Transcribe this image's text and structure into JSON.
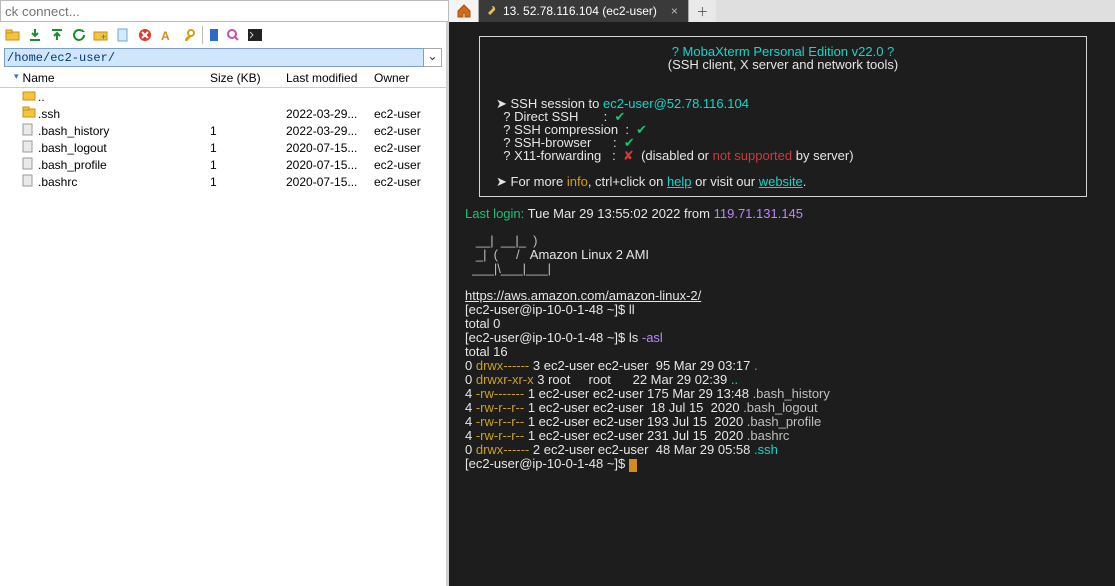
{
  "quickConnect": {
    "placeholder": "ck connect..."
  },
  "tab": {
    "title": "13. 52.78.116.104 (ec2-user)"
  },
  "sftp": {
    "path": "/home/ec2-user/",
    "columns": {
      "name": "Name",
      "size": "Size (KB)",
      "modified": "Last modified",
      "owner": "Owner"
    },
    "rows": [
      {
        "icon": "parent",
        "name": "..",
        "size": "",
        "mod": "",
        "own": ""
      },
      {
        "icon": "folder",
        "name": ".ssh",
        "size": "",
        "mod": "2022-03-29...",
        "own": "ec2-user"
      },
      {
        "icon": "file",
        "name": ".bash_history",
        "size": "1",
        "mod": "2022-03-29...",
        "own": "ec2-user"
      },
      {
        "icon": "file",
        "name": ".bash_logout",
        "size": "1",
        "mod": "2020-07-15...",
        "own": "ec2-user"
      },
      {
        "icon": "file",
        "name": ".bash_profile",
        "size": "1",
        "mod": "2020-07-15...",
        "own": "ec2-user"
      },
      {
        "icon": "file",
        "name": ".bashrc",
        "size": "1",
        "mod": "2020-07-15...",
        "own": "ec2-user"
      }
    ]
  },
  "terminal": {
    "banner": {
      "titleline": "    ? MobaXterm Personal Edition v22.0 ?    ",
      "subtitle": "(SSH client, X server and network tools)",
      "sessionPrefix": "➤ SSH session to ",
      "sessionUser": "ec2-user@52.78.116.104",
      "optDirect": "  ? Direct SSH       :  ",
      "optCompr": "  ? SSH compression  :  ",
      "optBrowse": "  ? SSH-browser      :  ",
      "optX11": "  ? X11-forwarding   :  ",
      "optX11tail1": "  (disabled",
      "optX11tail2": " or ",
      "optX11tail3": "not supported",
      "optX11tail4": " by server)",
      "infoPre": "➤ For more ",
      "infoWord": "info",
      "infoMid": ", ctrl+click on ",
      "helpWord": "help",
      "infoMid2": " or visit our ",
      "webWord": "website",
      "infoEnd": "."
    },
    "lastLoginLabel": "Last login:",
    "lastLoginRest": " Tue Mar 29 13:55:02 2022 from ",
    "lastLoginIp": "119.71.131.145",
    "art1": "   __|  __|_  )",
    "art2a": "   _|  (     /   ",
    "art2b": "Amazon Linux 2 AMI",
    "art3": "  ___|\\___|___|",
    "blank": "",
    "url": "https://aws.amazon.com/amazon-linux-2/",
    "prompt1": "[ec2-user@ip-10-0-1-48 ~]$ ",
    "cmd1": "ll",
    "out1": "total 0",
    "cmd2pre": "ls ",
    "cmd2flag": "-asl",
    "out2": "total 16",
    "ls": [
      {
        "blk": "0 ",
        "perm": "drwx------",
        "mid": " 3 ec2-user ec2-user  95 Mar 29 03:17 ",
        "name": ".",
        "color": "cyan"
      },
      {
        "blk": "0 ",
        "perm": "drwxr-xr-x",
        "mid": " 3 root     root      22 Mar 29 02:39 ",
        "name": "..",
        "color": "cyan"
      },
      {
        "blk": "4 ",
        "perm": "-rw-------",
        "mid": " 1 ec2-user ec2-user 175 Mar 29 13:48 ",
        "name": ".bash_history",
        "color": "gray"
      },
      {
        "blk": "4 ",
        "perm": "-rw-r--r--",
        "mid": " 1 ec2-user ec2-user  18 Jul 15  2020 ",
        "name": ".bash_logout",
        "color": "gray"
      },
      {
        "blk": "4 ",
        "perm": "-rw-r--r--",
        "mid": " 1 ec2-user ec2-user 193 Jul 15  2020 ",
        "name": ".bash_profile",
        "color": "gray"
      },
      {
        "blk": "4 ",
        "perm": "-rw-r--r--",
        "mid": " 1 ec2-user ec2-user 231 Jul 15  2020 ",
        "name": ".bashrc",
        "color": "gray"
      },
      {
        "blk": "0 ",
        "perm": "drwx------",
        "mid": " 2 ec2-user ec2-user  48 Mar 29 05:58 ",
        "name": ".ssh",
        "color": "cyan"
      }
    ]
  }
}
